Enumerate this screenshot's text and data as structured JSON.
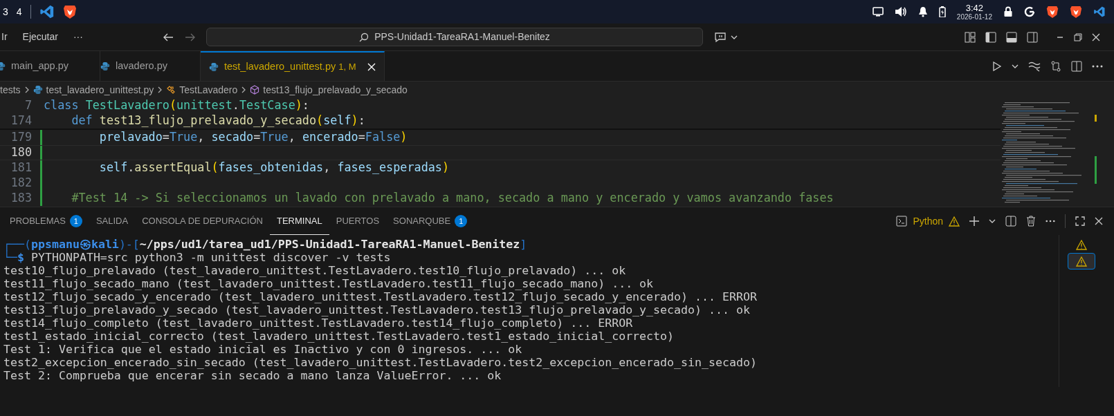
{
  "taskbar": {
    "workspaces": [
      "3",
      "4"
    ],
    "clock": {
      "time": "3:42",
      "date": "2026-01-12"
    }
  },
  "menu": [
    "Ir",
    "Ejecutar",
    "···"
  ],
  "command_center": {
    "value": "PPS-Unidad1-TareaRA1-Manuel-Benitez"
  },
  "tabs": [
    {
      "label": "main_app.py",
      "selected": false
    },
    {
      "label": "lavadero.py",
      "selected": false
    },
    {
      "label": "test_lavadero_unittest.py",
      "badge": "1, M",
      "selected": true
    }
  ],
  "breadcrumb": [
    {
      "text": "tests",
      "kind": "folder"
    },
    {
      "text": "test_lavadero_unittest.py",
      "kind": "file"
    },
    {
      "text": "TestLavadero",
      "kind": "class"
    },
    {
      "text": "test13_flujo_prelavado_y_secado",
      "kind": "method"
    }
  ],
  "editor": {
    "sticky_lines": [
      {
        "number": "7",
        "tokens": [
          {
            "text": "class ",
            "kind": "keyword"
          },
          {
            "text": "TestLavadero",
            "kind": "type"
          },
          {
            "text": "(",
            "kind": "bracket"
          },
          {
            "text": "unittest",
            "kind": "type"
          },
          {
            "text": ".",
            "kind": "plain"
          },
          {
            "text": "TestCase",
            "kind": "type"
          },
          {
            "text": ")",
            "kind": "bracket"
          },
          {
            "text": ":",
            "kind": "plain"
          }
        ]
      },
      {
        "number": "174",
        "tokens": [
          {
            "text": "    def ",
            "kind": "keyword"
          },
          {
            "text": "test13_flujo_prelavado_y_secado",
            "kind": "function"
          },
          {
            "text": "(",
            "kind": "bracket"
          },
          {
            "text": "self",
            "kind": "variable"
          },
          {
            "text": ")",
            "kind": "bracket"
          },
          {
            "text": ":",
            "kind": "plain"
          }
        ]
      }
    ],
    "lines": [
      {
        "number": "179",
        "current": false,
        "tokens": [
          {
            "text": "        prelavado",
            "kind": "variable"
          },
          {
            "text": "=",
            "kind": "plain"
          },
          {
            "text": "True",
            "kind": "keyword"
          },
          {
            "text": ", ",
            "kind": "plain"
          },
          {
            "text": "secado",
            "kind": "variable"
          },
          {
            "text": "=",
            "kind": "plain"
          },
          {
            "text": "True",
            "kind": "keyword"
          },
          {
            "text": ", ",
            "kind": "plain"
          },
          {
            "text": "encerado",
            "kind": "variable"
          },
          {
            "text": "=",
            "kind": "plain"
          },
          {
            "text": "False",
            "kind": "keyword"
          },
          {
            "text": ")",
            "kind": "bracket"
          }
        ]
      },
      {
        "number": "180",
        "current": true
      },
      {
        "number": "181",
        "current": false,
        "tokens": [
          {
            "text": "        self",
            "kind": "variable"
          },
          {
            "text": ".",
            "kind": "plain"
          },
          {
            "text": "assertEqual",
            "kind": "function"
          },
          {
            "text": "(",
            "kind": "bracket"
          },
          {
            "text": "fases_obtenidas",
            "kind": "variable"
          },
          {
            "text": ", ",
            "kind": "plain"
          },
          {
            "text": "fases_esperadas",
            "kind": "variable"
          },
          {
            "text": ")",
            "kind": "bracket"
          }
        ]
      },
      {
        "number": "182",
        "current": false
      },
      {
        "number": "183",
        "current": false,
        "tokens": [
          {
            "text": "    #Test 14 -> Si seleccionamos un lavado con prelavado a mano, secado a mano y encerado y vamos avanzando fases",
            "kind": "comment"
          }
        ]
      }
    ]
  },
  "panel": {
    "tabs": [
      {
        "label": "PROBLEMAS",
        "badge": "1",
        "selected": false
      },
      {
        "label": "SALIDA",
        "selected": false
      },
      {
        "label": "CONSOLA DE DEPURACIÓN",
        "selected": false
      },
      {
        "label": "TERMINAL",
        "selected": true
      },
      {
        "label": "PUERTOS",
        "selected": false
      },
      {
        "label": "SONARQUBE",
        "badge": "1",
        "selected": false
      }
    ],
    "terminal_profile": "Python",
    "terminal_list": [
      {
        "selected": false
      },
      {
        "selected": true
      }
    ],
    "terminal_lines": [
      [
        {
          "text": "┌──(",
          "kind": "frame"
        },
        {
          "text": "ppsmanu㉿kali",
          "kind": "user"
        },
        {
          "text": ")-[",
          "kind": "frame"
        },
        {
          "text": "~/pps/ud1/tarea_ud1/PPS-Unidad1-TareaRA1-Manuel-Benitez",
          "kind": "path"
        },
        {
          "text": "]",
          "kind": "frame"
        }
      ],
      [
        {
          "text": "└─",
          "kind": "frame"
        },
        {
          "text": "$ ",
          "kind": "user"
        },
        {
          "text": "PYTHONPATH=src python3 -m unittest discover -v tests",
          "kind": "plain"
        }
      ],
      [
        {
          "text": "test10_flujo_prelavado (test_lavadero_unittest.TestLavadero.test10_flujo_prelavado) ... ok",
          "kind": "plain"
        }
      ],
      [
        {
          "text": "test11_flujo_secado_mano (test_lavadero_unittest.TestLavadero.test11_flujo_secado_mano) ... ok",
          "kind": "plain"
        }
      ],
      [
        {
          "text": "test12_flujo_secado_y_encerado (test_lavadero_unittest.TestLavadero.test12_flujo_secado_y_encerado) ... ERROR",
          "kind": "plain"
        }
      ],
      [
        {
          "text": "test13_flujo_prelavado_y_secado (test_lavadero_unittest.TestLavadero.test13_flujo_prelavado_y_secado) ... ok",
          "kind": "plain"
        }
      ],
      [
        {
          "text": "test14_flujo_completo (test_lavadero_unittest.TestLavadero.test14_flujo_completo) ... ERROR",
          "kind": "plain"
        }
      ],
      [
        {
          "text": "test1_estado_inicial_correcto (test_lavadero_unittest.TestLavadero.test1_estado_inicial_correcto)",
          "kind": "plain"
        }
      ],
      [
        {
          "text": "Test 1: Verifica que el estado inicial es Inactivo y con 0 ingresos. ... ok",
          "kind": "plain"
        }
      ],
      [
        {
          "text": "test2_excepcion_encerado_sin_secado (test_lavadero_unittest.TestLavadero.test2_excepcion_encerado_sin_secado)",
          "kind": "plain"
        }
      ],
      [
        {
          "text": "Test 2: Comprueba que encerar sin secado a mano lanza ValueError. ... ok",
          "kind": "plain"
        }
      ]
    ]
  }
}
